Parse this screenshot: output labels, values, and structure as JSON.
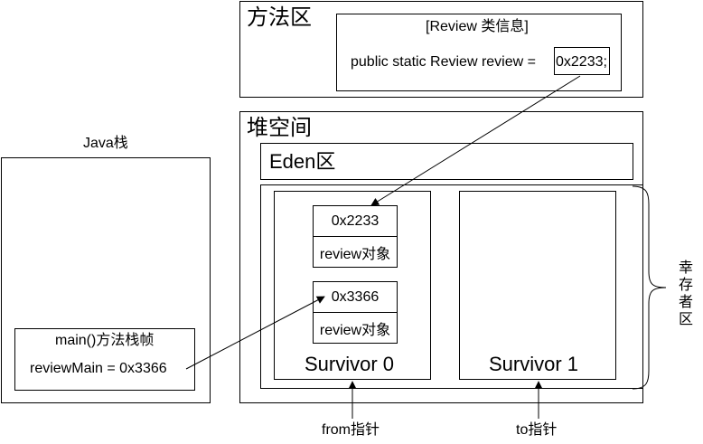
{
  "method_area": {
    "title": "方法区",
    "class_info_label": "[Review 类信息]",
    "field_decl": "public static Review review =",
    "field_value": "0x2233;"
  },
  "heap": {
    "title": "堆空间",
    "eden_label": "Eden区",
    "survivor0": {
      "label": "Survivor 0",
      "objects": [
        {
          "address": "0x2233",
          "name": "review对象"
        },
        {
          "address": "0x3366",
          "name": "review对象"
        }
      ]
    },
    "survivor1": {
      "label": "Survivor 1"
    },
    "survivor_region_label": "幸存者区",
    "from_pointer": "from指针",
    "to_pointer": "to指针"
  },
  "java_stack": {
    "title": "Java栈",
    "frame_title": "main()方法栈帧",
    "local_var": "reviewMain = 0x3366"
  }
}
